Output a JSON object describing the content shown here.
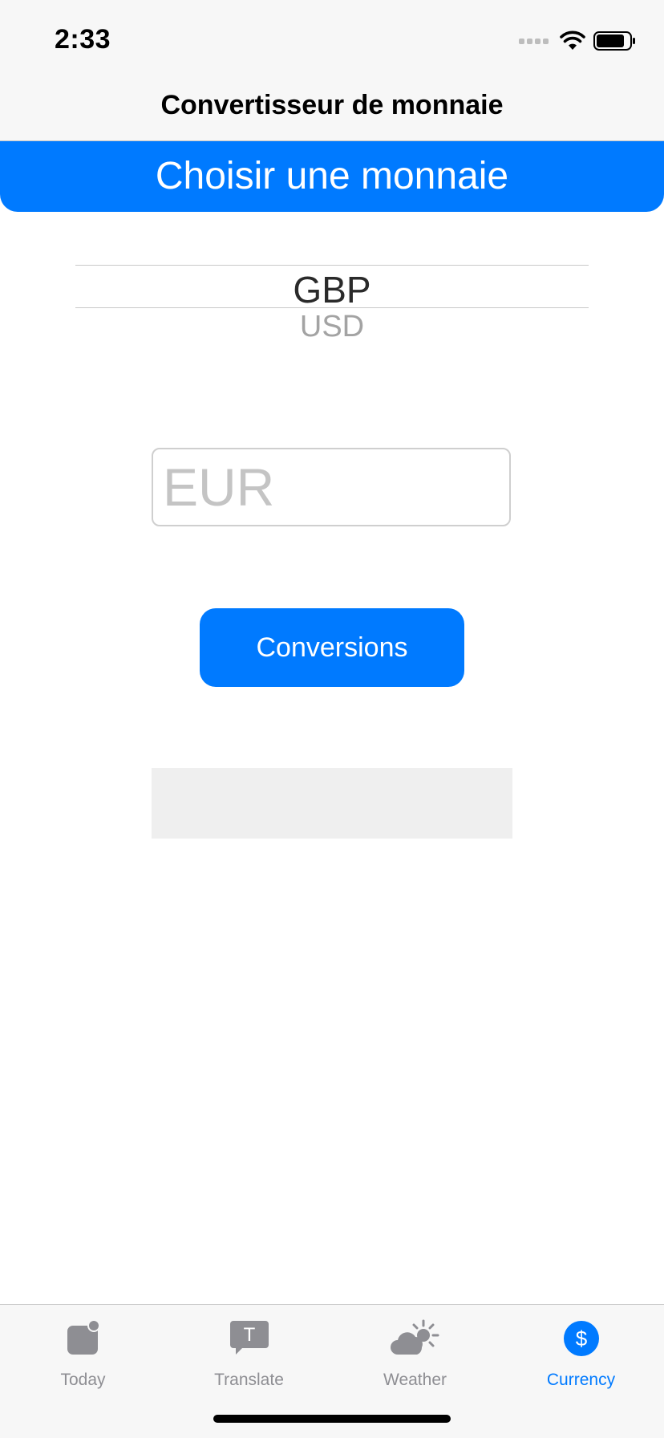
{
  "status_bar": {
    "time": "2:33"
  },
  "navigation": {
    "title": "Convertisseur de monnaie"
  },
  "banner": {
    "label": "Choisir une monnaie"
  },
  "picker": {
    "selected": "GBP",
    "next": "USD"
  },
  "amount_input": {
    "value": "",
    "placeholder": "EUR"
  },
  "convert_button": {
    "label": "Conversions"
  },
  "result": {
    "text": ""
  },
  "tab_bar": {
    "items": [
      {
        "label": "Today",
        "icon": "today-icon"
      },
      {
        "label": "Translate",
        "icon": "translate-icon"
      },
      {
        "label": "Weather",
        "icon": "weather-icon"
      },
      {
        "label": "Currency",
        "icon": "currency-icon",
        "active": true
      }
    ]
  },
  "colors": {
    "accent": "#007aff",
    "inactive_tab": "#8e8e93",
    "result_bg": "#efefef"
  }
}
